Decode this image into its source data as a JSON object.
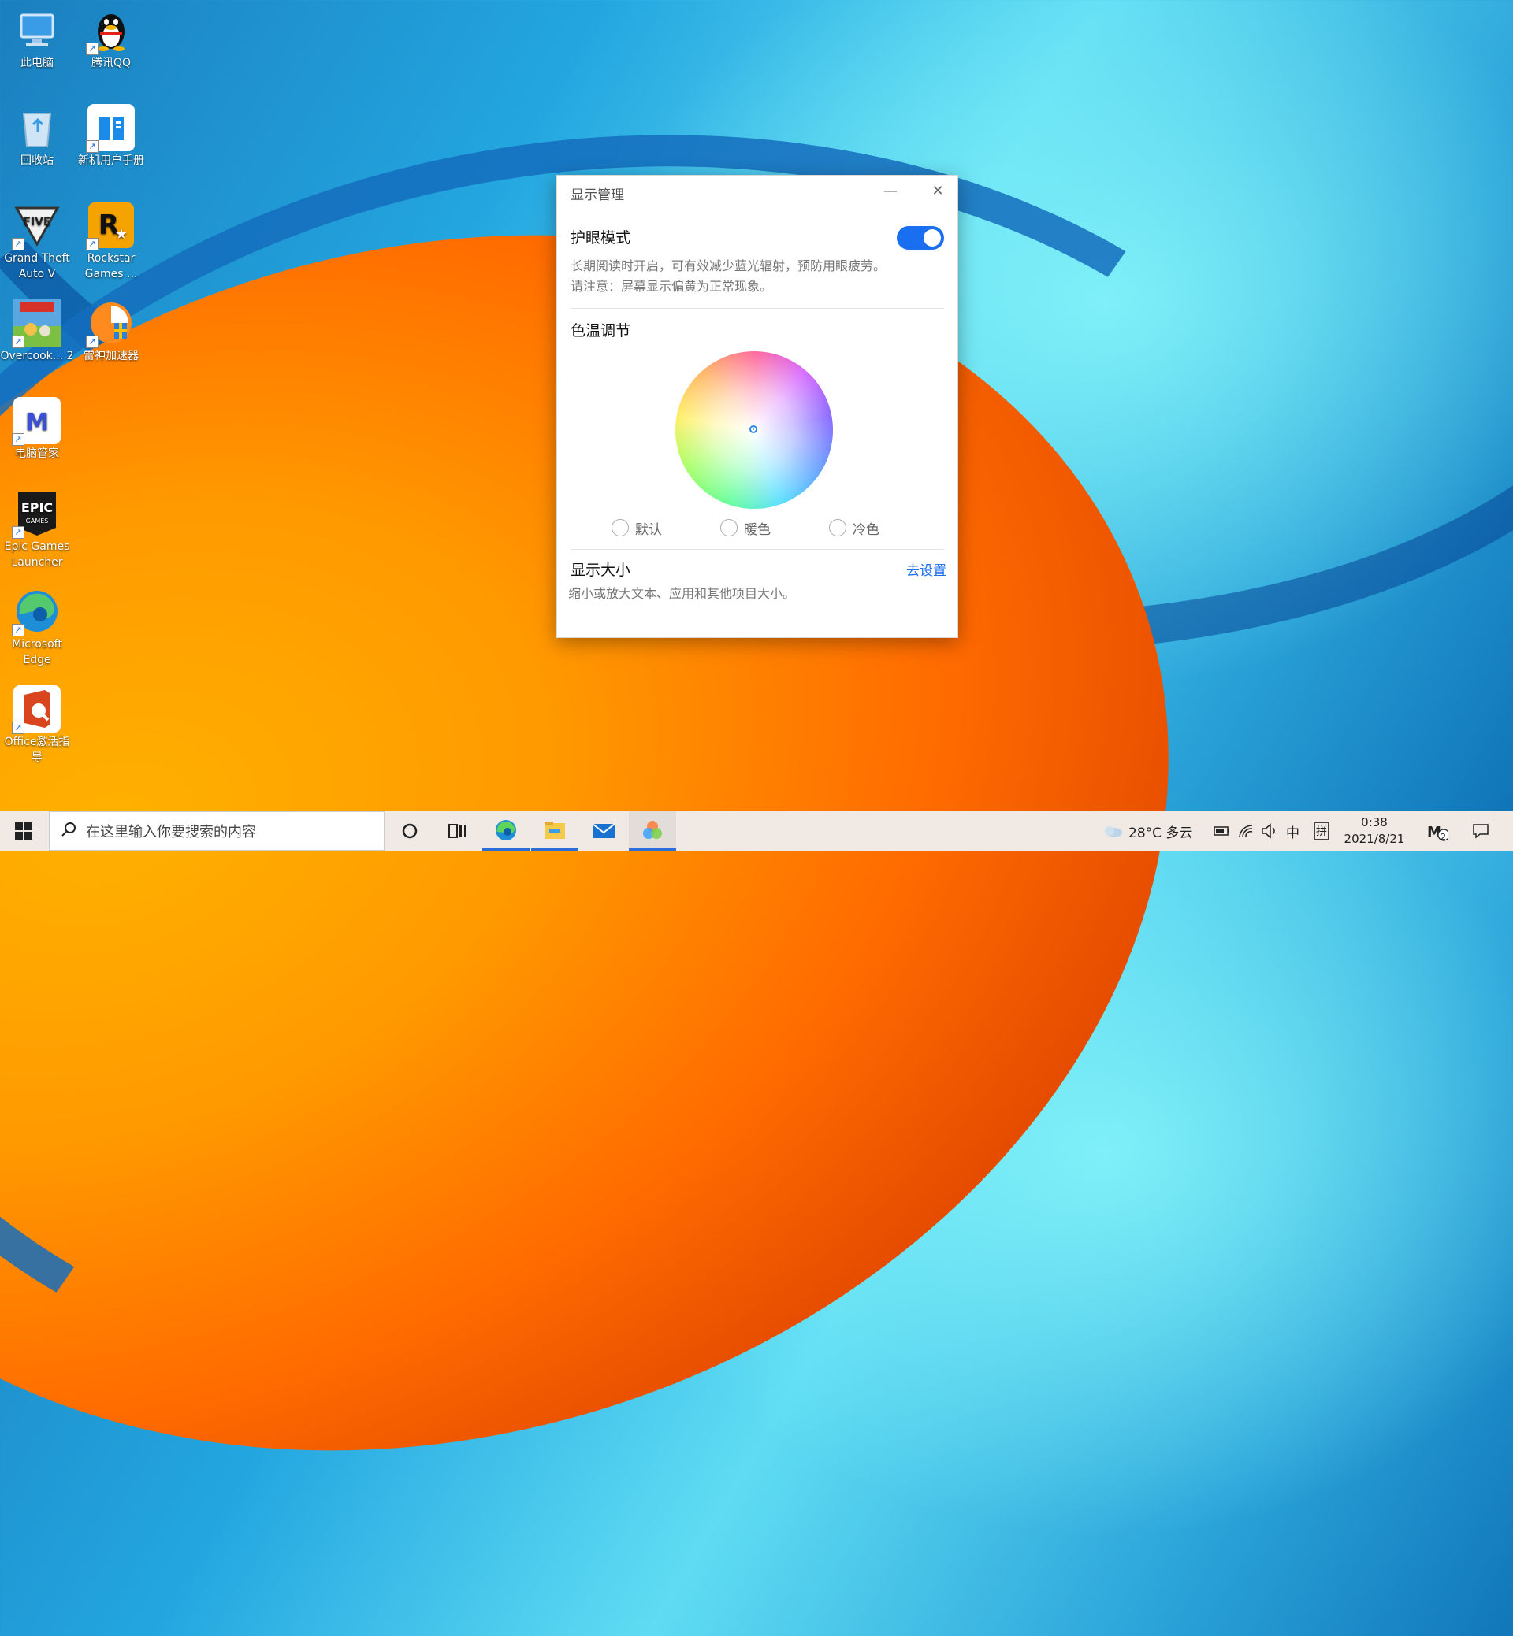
{
  "desktop": {
    "icons": [
      {
        "label": "此电脑",
        "icon": "computer-icon"
      },
      {
        "label": "腾讯QQ",
        "icon": "qq-penguin-icon"
      },
      {
        "label": "回收站",
        "icon": "recycle-bin-icon"
      },
      {
        "label": "新机用户手册",
        "icon": "manual-book-icon"
      },
      {
        "label": "Grand Theft Auto V",
        "icon": "gta-v-icon"
      },
      {
        "label": "Rockstar Games ...",
        "icon": "rockstar-icon"
      },
      {
        "label": "Overcook... 2",
        "icon": "overcooked-icon"
      },
      {
        "label": "雷神加速器",
        "icon": "accelerator-icon"
      },
      {
        "label": "电脑管家",
        "icon": "pc-manager-icon"
      },
      {
        "label": "Epic Games Launcher",
        "icon": "epic-games-icon"
      },
      {
        "label": "Microsoft Edge",
        "icon": "edge-icon"
      },
      {
        "label": "Office激活指导",
        "icon": "office-icon"
      }
    ]
  },
  "dialog": {
    "title": "显示管理",
    "eye_care": {
      "title": "护眼模式",
      "desc_line1": "长期阅读时开启，可有效减少蓝光辐射，预防用眼疲劳。",
      "desc_line2": "请注意：屏幕显示偏黄为正常现象。",
      "enabled": true
    },
    "color_temp": {
      "title": "色温调节",
      "options": [
        "默认",
        "暖色",
        "冷色"
      ]
    },
    "display_size": {
      "title": "显示大小",
      "link": "去设置",
      "desc": "缩小或放大文本、应用和其他项目大小。"
    }
  },
  "taskbar": {
    "search_placeholder": "在这里输入你要搜索的内容",
    "weather": "28°C 多云",
    "ime1": "中",
    "ime2": "拼",
    "time": "0:38",
    "date": "2021/8/21",
    "notification_count": "2",
    "colors": {
      "accent": "#1a6ef0",
      "taskbar_bg": "#f0e9e4"
    }
  }
}
